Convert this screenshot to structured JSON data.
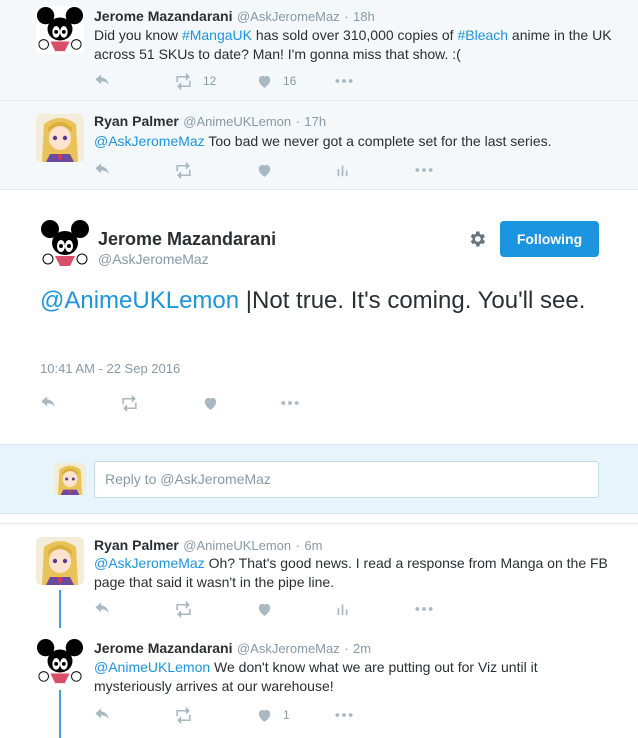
{
  "tweets": {
    "t1": {
      "name": "Jerome Mazandarani",
      "handle": "@AskJeromeMaz",
      "dot": "·",
      "time": "18h",
      "text_a": "Did you know ",
      "tag1": "#MangaUK",
      "text_b": " has sold over 310,000 copies of ",
      "tag2": "#Bleach",
      "text_c": " anime in the UK across 51 SKUs to date? Man! I'm gonna miss that show. :(",
      "retweets": "12",
      "likes": "16",
      "avatar_icon": "mickey-avatar-icon"
    },
    "t2": {
      "name": "Ryan Palmer",
      "handle": "@AnimeUKLemon",
      "dot": "·",
      "time": "17h",
      "mention": "@AskJeromeMaz",
      "text": " Too bad we never got a complete set for the last series.",
      "avatar_icon": "anime-girl-avatar-icon"
    },
    "focus": {
      "name": "Jerome Mazandarani",
      "handle": "@AskJeromeMaz",
      "mention": "@AnimeUKLemon",
      "text": " |Not true. It's coming. You'll see.",
      "timestamp": "10:41 AM - 22 Sep 2016",
      "follow_label": "Following"
    },
    "reply_box": {
      "placeholder": "Reply to @AskJeromeMaz"
    },
    "t3": {
      "name": "Ryan Palmer",
      "handle": "@AnimeUKLemon",
      "dot": "·",
      "time": "6m",
      "mention": "@AskJeromeMaz",
      "text": " Oh? That's good news. I read a response from Manga on the FB page that said it wasn't in the pipe line."
    },
    "t4": {
      "name": "Jerome Mazandarani",
      "handle": "@AskJeromeMaz",
      "dot": "·",
      "time": "2m",
      "mention": "@AnimeUKLemon",
      "text": " We don't know what we are putting out for Viz until it mysteriously arrives at our warehouse!",
      "likes": "1"
    }
  },
  "colors": {
    "accent": "#1b95e0",
    "thread_line": "#3fa1d8",
    "muted": "#8899a6",
    "icon": "#aab8c2"
  }
}
